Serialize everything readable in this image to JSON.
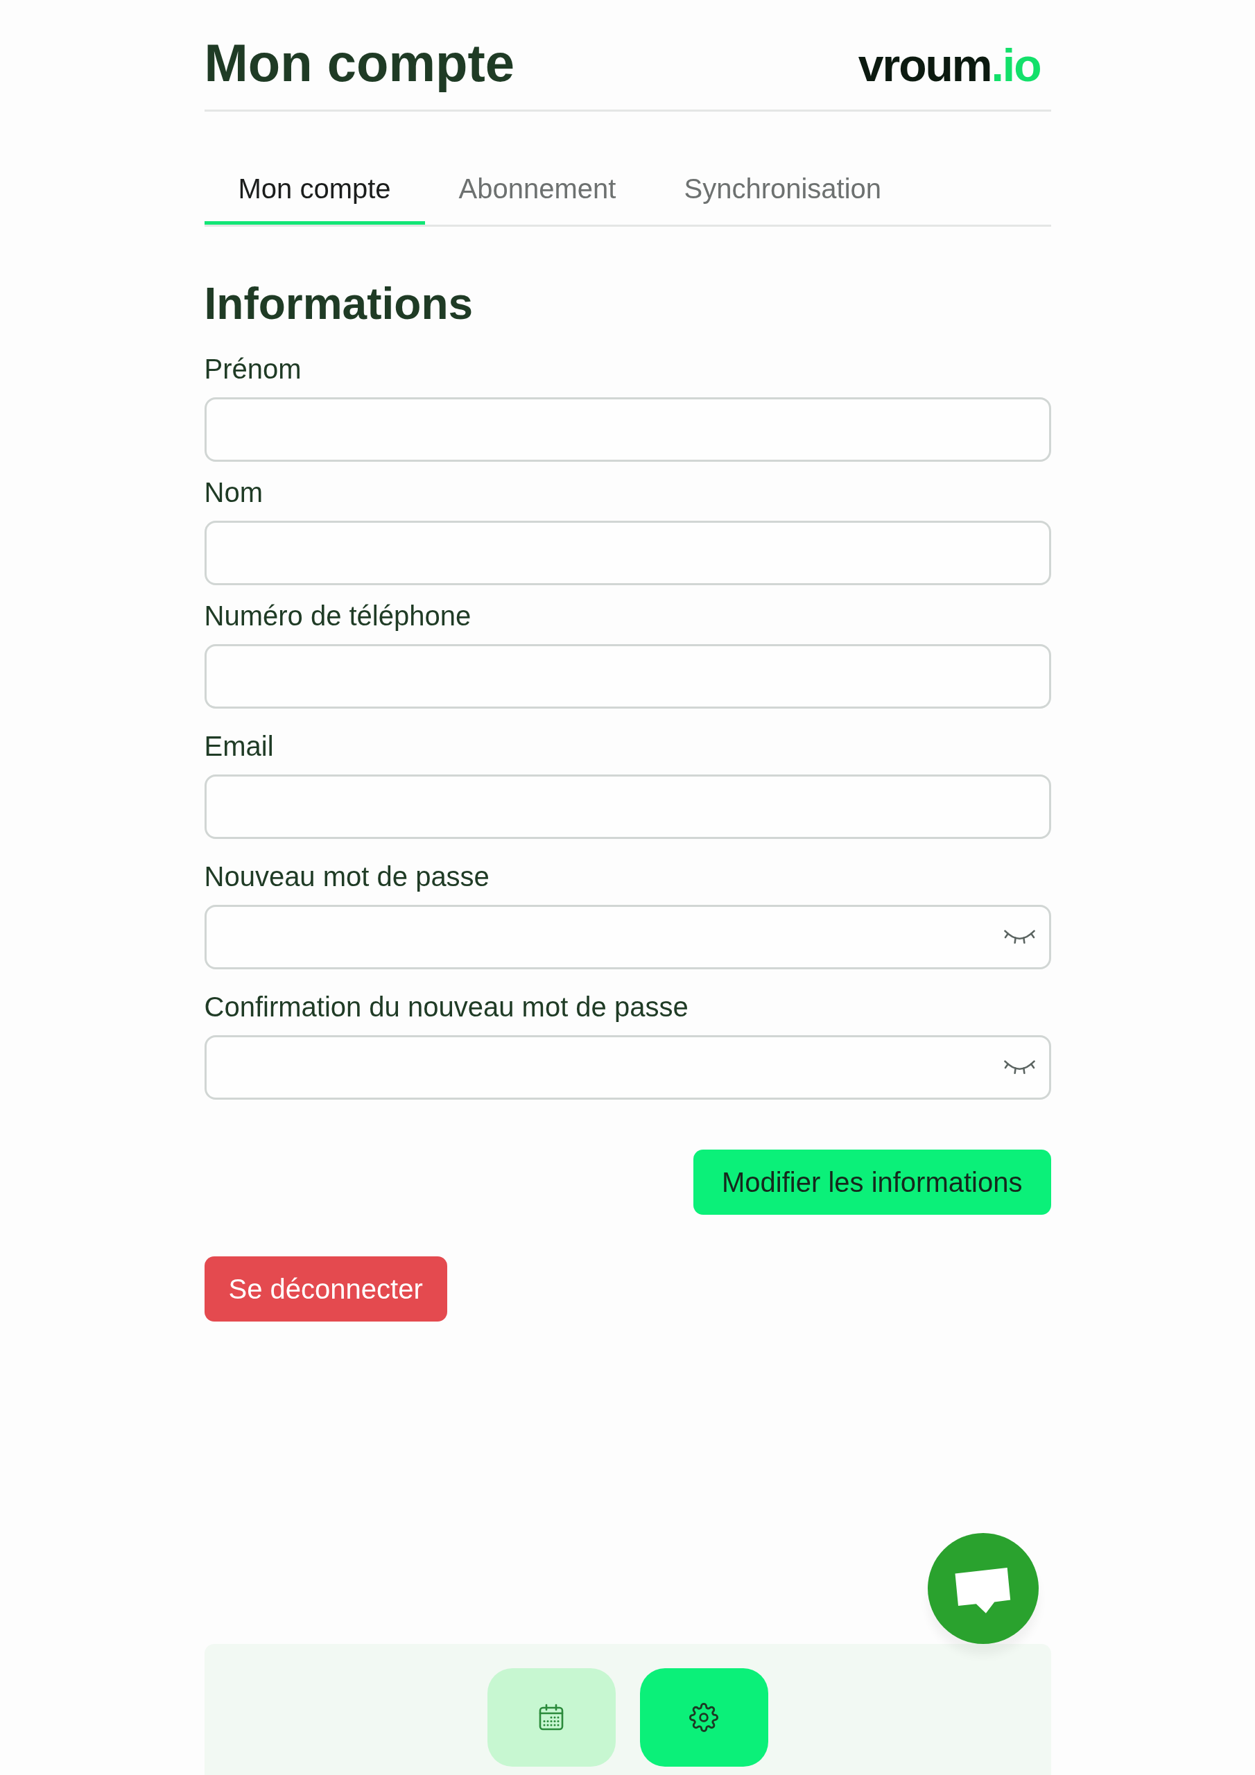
{
  "header": {
    "title": "Mon compte",
    "logo": {
      "name": "vroum",
      "suffix": ".io"
    }
  },
  "tabs": [
    {
      "label": "Mon compte",
      "selected": true
    },
    {
      "label": "Abonnement",
      "selected": false
    },
    {
      "label": "Synchronisation",
      "selected": false
    }
  ],
  "section": {
    "title": "Informations",
    "fields": [
      {
        "label": "Prénom",
        "kind": "text"
      },
      {
        "label": "Nom",
        "kind": "text"
      },
      {
        "label": "Numéro de téléphone",
        "kind": "text"
      },
      {
        "label": "Email",
        "kind": "text"
      },
      {
        "label": "Nouveau mot de passe",
        "kind": "password"
      },
      {
        "label": "Confirmation du nouveau mot de passe",
        "kind": "password"
      }
    ],
    "actions": [
      {
        "label": "Modifier les informations",
        "kind": "primary"
      },
      {
        "label": "Se déconnecter",
        "kind": "danger"
      }
    ]
  },
  "nav": {
    "items": [
      {
        "kind": "calendar",
        "selected": false
      },
      {
        "kind": "settings",
        "selected": true
      }
    ]
  }
}
